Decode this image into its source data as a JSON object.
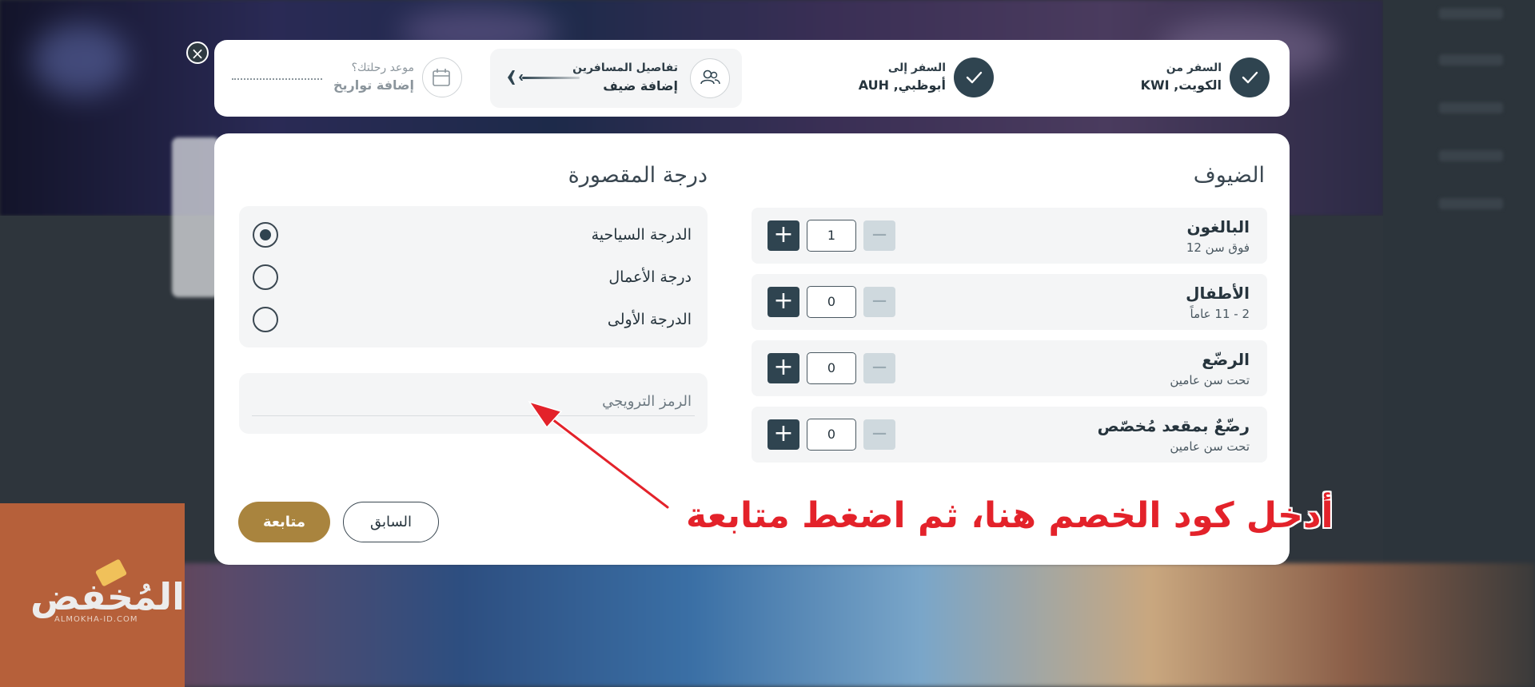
{
  "steps": {
    "from": {
      "label": "السفر من",
      "value": "الكويت, KWI"
    },
    "to": {
      "label": "السفر إلى",
      "value": "أبوظبي, AUH"
    },
    "passengers": {
      "label": "تفاصيل المسافرين",
      "value": "إضافة ضيف"
    },
    "dates": {
      "label": "موعد رحلتك؟",
      "value": "إضافة تواريخ"
    }
  },
  "guests": {
    "title": "الضيوف",
    "rows": [
      {
        "label": "البالغون",
        "sub": "فوق سن 12",
        "count": "1"
      },
      {
        "label": "الأطفال",
        "sub": "2 - 11 عاماً",
        "count": "0"
      },
      {
        "label": "الرضّع",
        "sub": "تحت سن عامين",
        "count": "0"
      },
      {
        "label": "رضّعٌ بمقعد مُخصّص",
        "sub": "تحت سن عامين",
        "count": "0"
      }
    ]
  },
  "cabin": {
    "title": "درجة المقصورة",
    "options": [
      {
        "label": "الدرجة السياحية",
        "selected": true
      },
      {
        "label": "درجة الأعمال",
        "selected": false
      },
      {
        "label": "الدرجة الأولى",
        "selected": false
      }
    ]
  },
  "promo": {
    "placeholder": "الرمز الترويجي",
    "value": ""
  },
  "buttons": {
    "back": "السابق",
    "next": "متابعة",
    "close": "×"
  },
  "annotation": {
    "text": "أدخل كود الخصم هنا، ثم اضغط متابعة"
  },
  "logo": {
    "name": "المُخفض",
    "domain": "ALMOKHA-ID.COM"
  },
  "colors": {
    "primary": "#2f4450",
    "accent": "#a9843e",
    "annotation": "#e3222a",
    "logo_bg": "#b6603a"
  }
}
